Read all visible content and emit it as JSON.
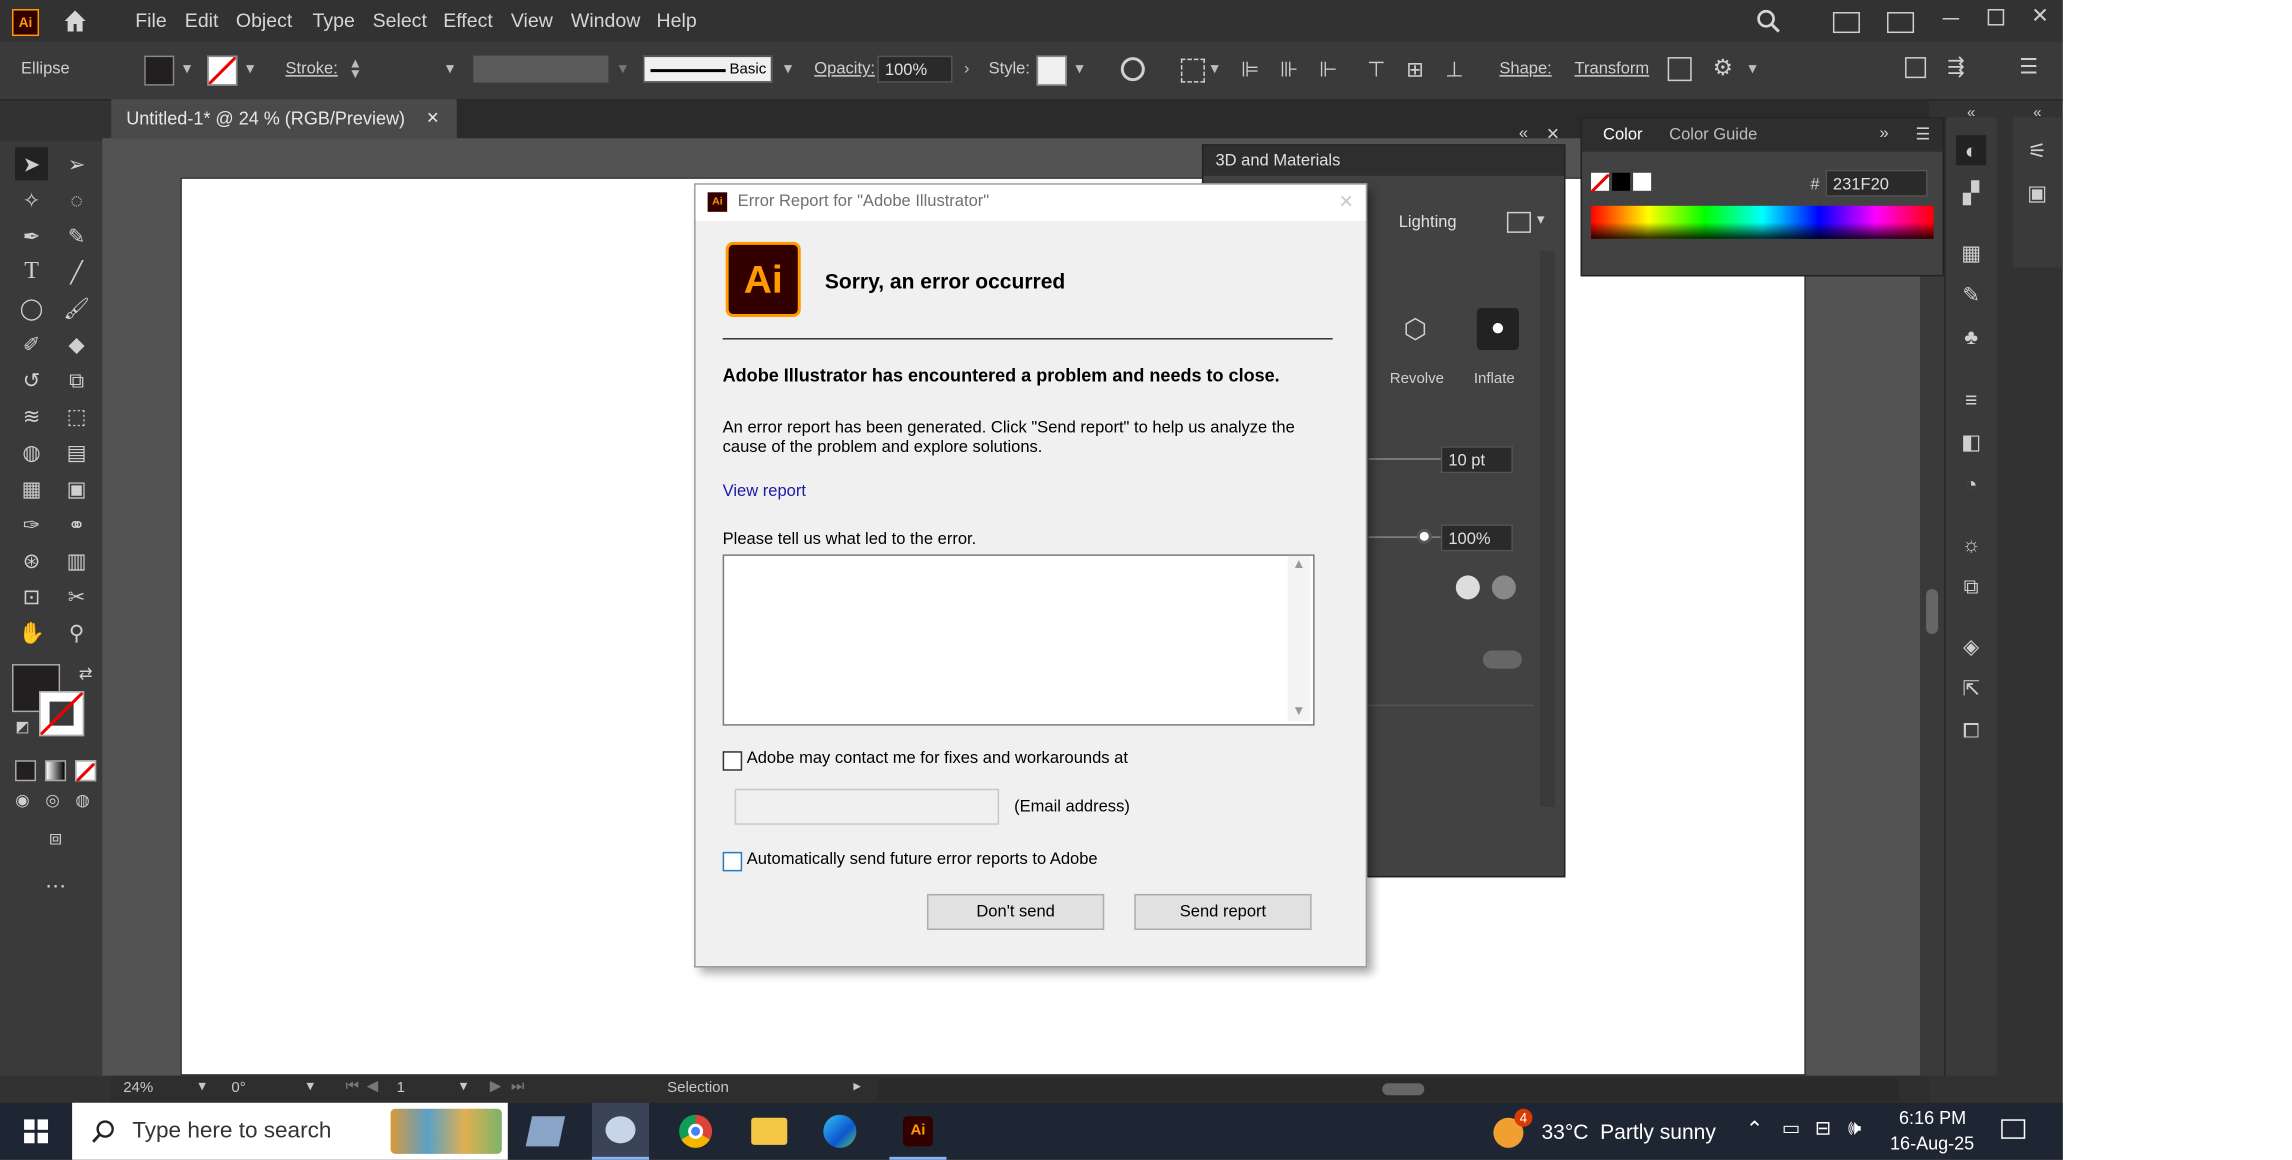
{
  "menu": {
    "items": [
      "File",
      "Edit",
      "Object",
      "Type",
      "Select",
      "Effect",
      "View",
      "Window",
      "Help"
    ]
  },
  "control_bar": {
    "tool_name": "Ellipse",
    "stroke_label": "Stroke:",
    "brush_style": "Basic",
    "opacity_label": "Opacity:",
    "opacity_value": "100%",
    "style_label": "Style:",
    "shape_label": "Shape:",
    "transform_label": "Transform"
  },
  "document_tab": {
    "title": "Untitled-1* @ 24 % (RGB/Preview)",
    "close": "×"
  },
  "panel_3d": {
    "title": "3D and Materials",
    "lighting_label": "Lighting",
    "revolve_label": "Revolve",
    "inflate_label": "Inflate",
    "depth_value": "10 pt",
    "percent_value": "100%"
  },
  "color_panel": {
    "tab_color": "Color",
    "tab_guide": "Color Guide",
    "hex_prefix": "#",
    "hex_value": "231F20"
  },
  "status_bar": {
    "zoom": "24%",
    "rotate": "0°",
    "artboard": "1",
    "tool": "Selection"
  },
  "taskbar": {
    "search_placeholder": "Type here to search",
    "weather_badge": "4",
    "weather": "33°C  Partly sunny",
    "time": "6:16 PM",
    "date": "16-Aug-25"
  },
  "dialog": {
    "title": "Error Report for \"Adobe Illustrator\"",
    "close": "✕",
    "logo_text": "Ai",
    "heading": "Sorry, an error occurred",
    "problem": "Adobe Illustrator has encountered a problem and needs to close.",
    "description": "An error report has been generated. Click \"Send report\" to help us analyze the cause of the problem and explore solutions.",
    "view_report": "View report",
    "prompt": "Please tell us what led to the error.",
    "textarea_value": "",
    "contact_label": "Adobe may contact me for fixes and workarounds at",
    "email_value": "",
    "email_label": "(Email address)",
    "auto_send_label": "Automatically send future error reports to Adobe",
    "dont_send": "Don't send",
    "send_report": "Send report"
  },
  "colors": {
    "app_bg": "#323232",
    "ai_brand": "#330000",
    "ai_text": "#ff9a00",
    "link": "#1a1aaa",
    "fill_swatch": "#231f20"
  }
}
